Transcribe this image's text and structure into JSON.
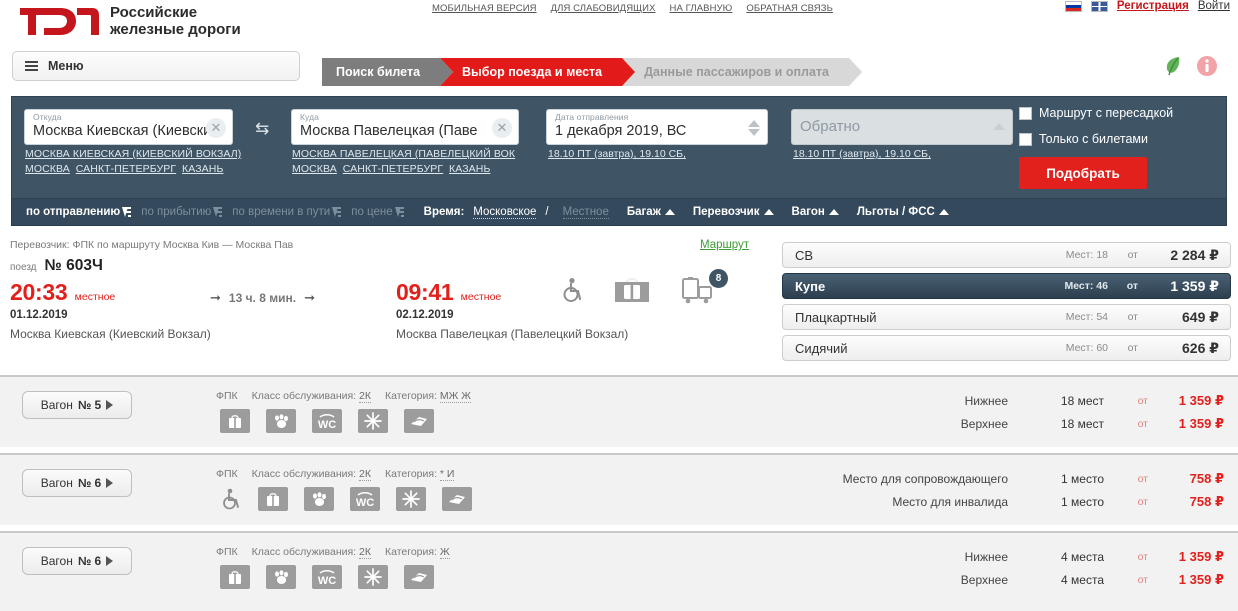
{
  "header": {
    "brand_line1": "Российские",
    "brand_line2": "железные дороги",
    "top_links": [
      "МОБИЛЬНАЯ ВЕРСИЯ",
      "ДЛЯ СЛАБОВИДЯЩИХ",
      "НА ГЛАВНУЮ",
      "ОБРАТНАЯ СВЯЗЬ"
    ],
    "register_label": "Регистрация",
    "login_label": "Войти",
    "menu_label": "Меню",
    "steps": [
      {
        "label": "Поиск билета",
        "state": "done"
      },
      {
        "label": "Выбор поезда и места",
        "state": "active"
      },
      {
        "label": "Данные пассажиров и оплата",
        "state": "todo"
      }
    ]
  },
  "search": {
    "from": {
      "label": "Откуда",
      "value": "Москва Киевская (Киевски",
      "suggest_main": "МОСКВА КИЕВСКАЯ (КИЕВСКИЙ ВОКЗАЛ)",
      "suggest_list": [
        "МОСКВА",
        "САНКТ-ПЕТЕРБУРГ",
        "КАЗАНЬ"
      ]
    },
    "to": {
      "label": "Куда",
      "value": "Москва Павелецкая (Паве",
      "suggest_main": "МОСКВА ПАВЕЛЕЦКАЯ (ПАВЕЛЕЦКИЙ ВОК",
      "suggest_list": [
        "МОСКВА",
        "САНКТ-ПЕТЕРБУРГ",
        "КАЗАНЬ"
      ]
    },
    "date": {
      "label": "Дата отправления",
      "value": "1 декабря 2019, ВС",
      "quick": "18.10 ПТ (завтра), 19.10 СБ,"
    },
    "back": {
      "placeholder": "Обратно",
      "quick": "18.10 ПТ (завтра), 19.10 СБ,"
    },
    "checkbox_transfer": "Маршрут с пересадкой",
    "checkbox_tickets_only": "Только с билетами",
    "submit_label": "Подобрать"
  },
  "filters": {
    "sorts": [
      {
        "label": "по отправлению",
        "active": true
      },
      {
        "label": "по прибытию",
        "active": false
      },
      {
        "label": "по времени в пути",
        "active": false
      },
      {
        "label": "по цене",
        "active": false
      }
    ],
    "time_label": "Время:",
    "time_moscow": "Московское",
    "time_local": "Местное",
    "dropdowns": [
      "Багаж",
      "Перевозчик",
      "Вагон",
      "Льготы / ФСС"
    ]
  },
  "train": {
    "carrier_line": "Перевозчик: ФПК    по маршруту Москва Кив — Москва Пав",
    "train_label": "поезд",
    "train_number": "№ 603Ч",
    "departure": {
      "time": "20:33",
      "time_suffix": "местное",
      "date": "01.12.2019",
      "station": "Москва Киевская (Киевский Вокзал)"
    },
    "arrival": {
      "time": "09:41",
      "time_suffix": "местное",
      "date": "02.12.2019",
      "station": "Москва Павелецкая (Павелецкий Вокзал)"
    },
    "duration": "13 ч. 8 мин.",
    "route_link": "Маршрут",
    "luggage_badge": "8",
    "classes": [
      {
        "name": "СВ",
        "seats": "Мест: 18",
        "from": "от",
        "price": "2 284 ₽",
        "selected": false
      },
      {
        "name": "Купе",
        "seats": "Мест: 46",
        "from": "от",
        "price": "1 359 ₽",
        "selected": true
      },
      {
        "name": "Плацкартный",
        "seats": "Мест: 54",
        "from": "от",
        "price": "649 ₽",
        "selected": false
      },
      {
        "name": "Сидячий",
        "seats": "Мест: 60",
        "from": "от",
        "price": "626 ₽",
        "selected": false
      }
    ]
  },
  "wagons": [
    {
      "btn_prefix": "Вагон",
      "btn_number": "№ 5",
      "carrier": "ФПК",
      "service_label": "Класс обслуживания:",
      "service_value": "2К",
      "category_label": "Категория:",
      "category_value": "МЖ Ж",
      "icons": [
        "luggage-icon",
        "pets-icon",
        "wc-icon",
        "air-conditioning-icon",
        "bedding-icon"
      ],
      "seats": [
        {
          "name": "Нижнее",
          "count": "18 мест",
          "from": "от",
          "price": "1 359 ₽"
        },
        {
          "name": "Верхнее",
          "count": "18 мест",
          "from": "от",
          "price": "1 359 ₽"
        }
      ]
    },
    {
      "btn_prefix": "Вагон",
      "btn_number": "№ 6",
      "carrier": "ФПК",
      "service_label": "Класс обслуживания:",
      "service_value": "2К",
      "category_label": "Категория:",
      "category_value": "* И",
      "icons": [
        "wheelchair-icon",
        "luggage-icon",
        "pets-icon",
        "wc-icon",
        "air-conditioning-icon",
        "bedding-icon"
      ],
      "seats": [
        {
          "name": "Место для сопровождающего",
          "count": "1 место",
          "from": "от",
          "price": "758 ₽"
        },
        {
          "name": "Место для инвалида",
          "count": "1 место",
          "from": "от",
          "price": "758 ₽"
        }
      ]
    },
    {
      "btn_prefix": "Вагон",
      "btn_number": "№ 6",
      "carrier": "ФПК",
      "service_label": "Класс обслуживания:",
      "service_value": "2К",
      "category_label": "Категория:",
      "category_value": "Ж",
      "icons": [
        "luggage-icon",
        "pets-icon",
        "wc-icon",
        "air-conditioning-icon",
        "bedding-icon"
      ],
      "seats": [
        {
          "name": "Нижнее",
          "count": "4 места",
          "from": "от",
          "price": "1 359 ₽"
        },
        {
          "name": "Верхнее",
          "count": "4 места",
          "from": "от",
          "price": "1 359 ₽"
        }
      ]
    }
  ],
  "colors": {
    "brand_red": "#e2211c",
    "panel_blue": "#3f5566",
    "filter_blue": "#34495b",
    "link_green": "#3d9b35"
  }
}
